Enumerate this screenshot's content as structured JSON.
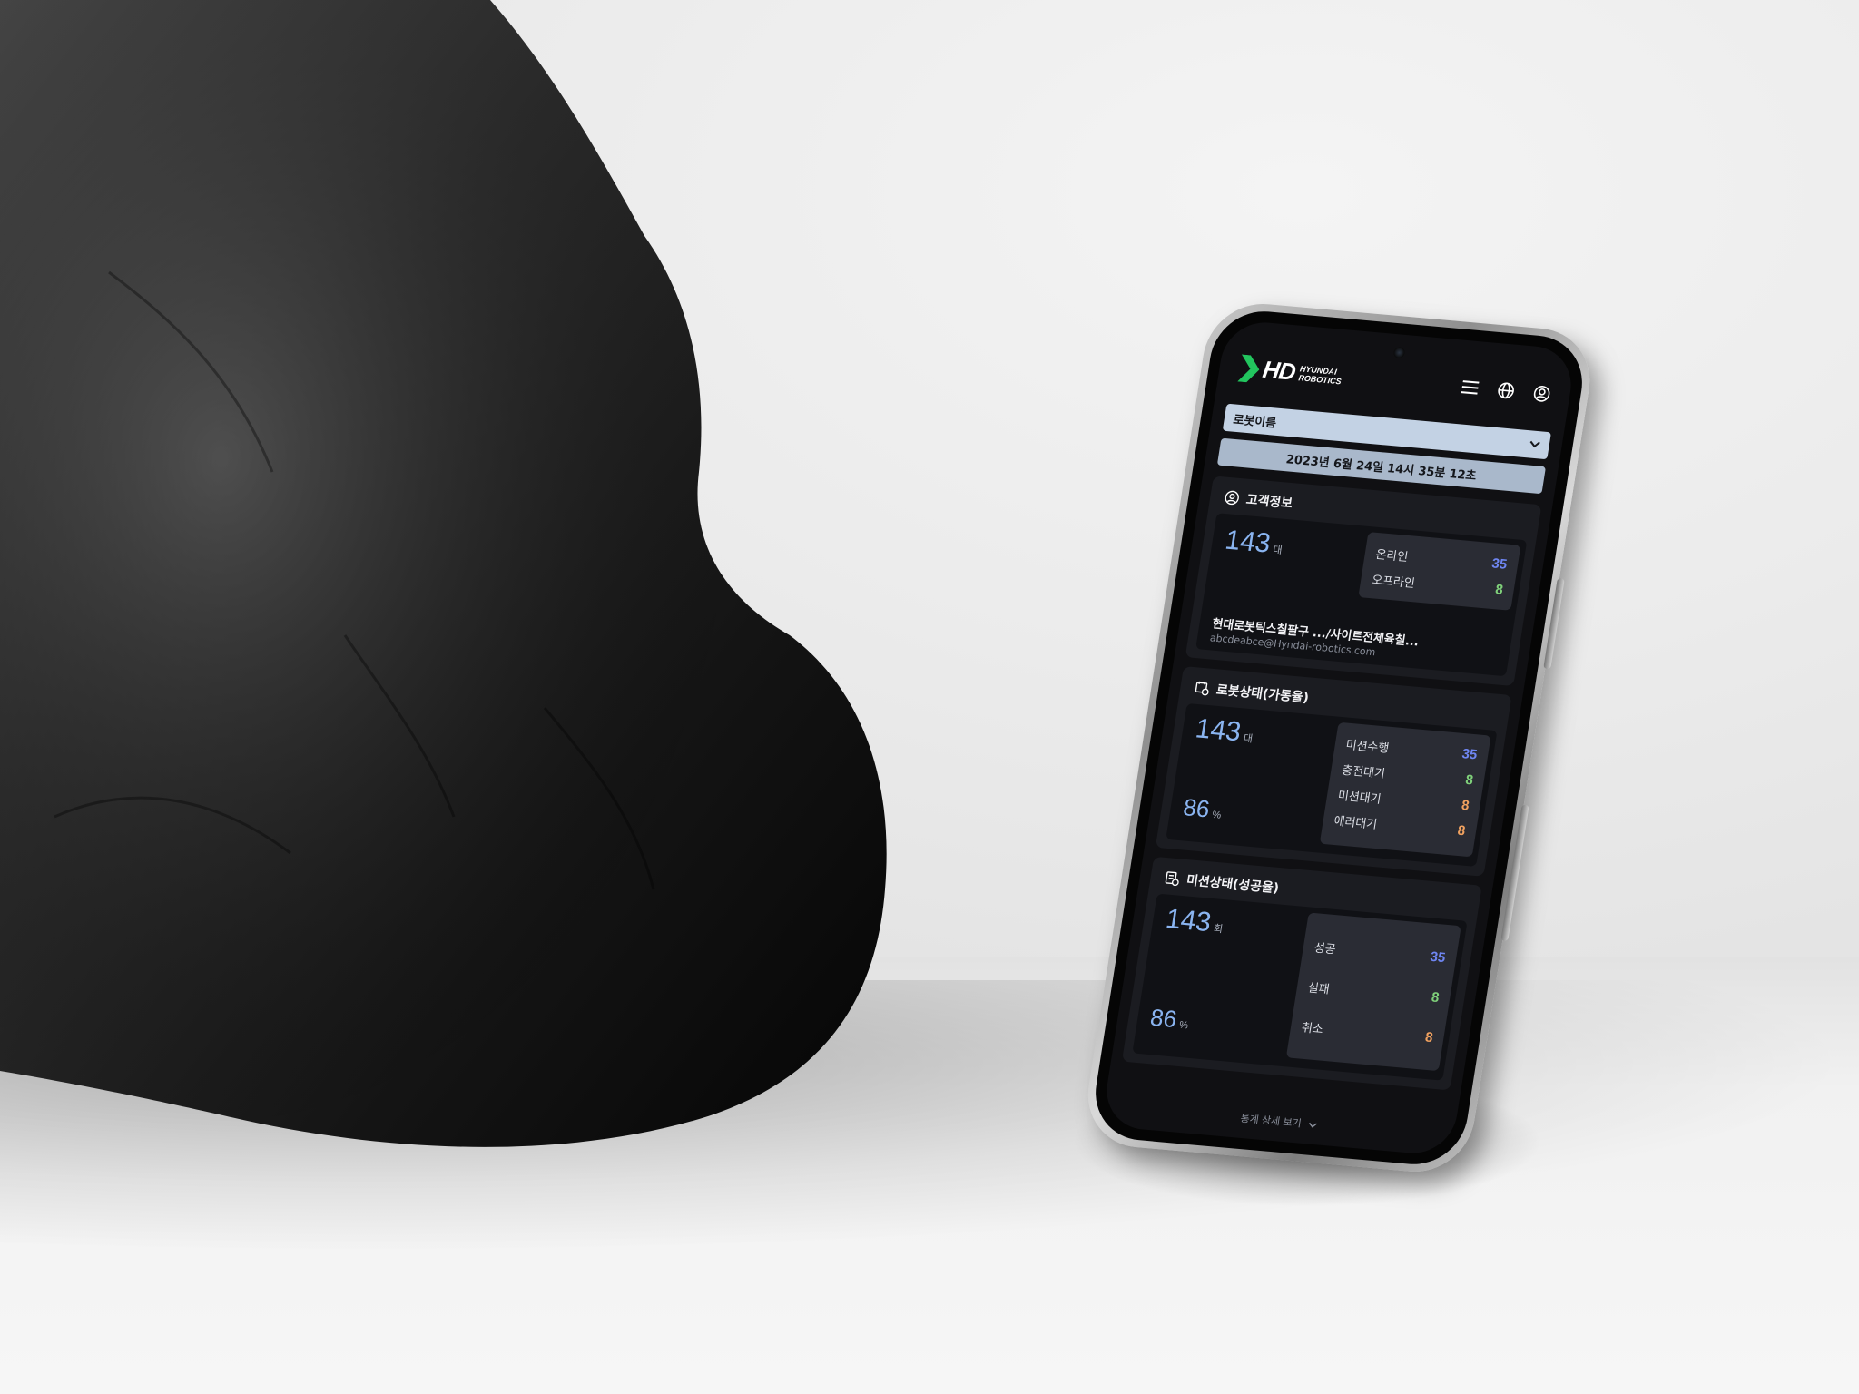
{
  "brand": {
    "logo_text": "HD",
    "logo_sub_line1": "HYUNDAI",
    "logo_sub_line2": "ROBOTICS",
    "accent_color": "#22c55e"
  },
  "header": {
    "icons": [
      "menu-icon",
      "globe-icon",
      "user-icon"
    ]
  },
  "robot_select": {
    "value": "로봇이름"
  },
  "datetime": "2023년 6월 24일 14시 35분 12초",
  "customer_card": {
    "title": "고객정보",
    "total": "143",
    "unit": "대",
    "rows": [
      {
        "label": "온라인",
        "value": "35"
      },
      {
        "label": "오프라인",
        "value": "8"
      }
    ],
    "name": "현대로봇틱스칠팔구 .../사이트전체육칠...",
    "email": "abcdeabce@Hyndai-robotics.com"
  },
  "robot_status_card": {
    "title": "로봇상태(가동율)",
    "total": "143",
    "unit": "대",
    "rate": "86",
    "rate_unit": "%",
    "rows": [
      {
        "label": "미션수행",
        "value": "35"
      },
      {
        "label": "충전대기",
        "value": "8"
      },
      {
        "label": "미션대기",
        "value": "8"
      },
      {
        "label": "에러대기",
        "value": "8"
      }
    ]
  },
  "mission_status_card": {
    "title": "미션상태(성공율)",
    "total": "143",
    "unit": "회",
    "rate": "86",
    "rate_unit": "%",
    "rows": [
      {
        "label": "성공",
        "value": "35"
      },
      {
        "label": "실패",
        "value": "8"
      },
      {
        "label": "취소",
        "value": "8"
      }
    ]
  },
  "footer": {
    "link_label": "통계 상세 보기"
  }
}
